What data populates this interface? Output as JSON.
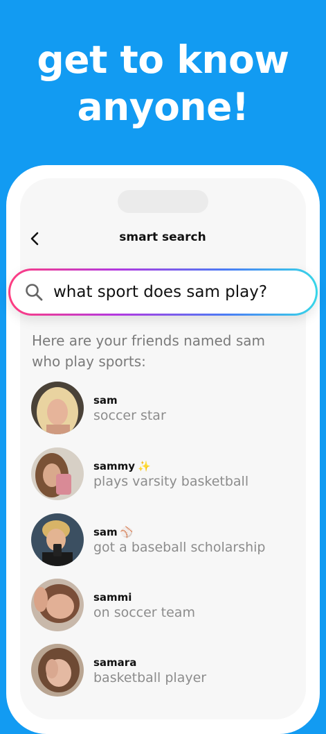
{
  "headline": {
    "line1": "get to know",
    "line2": "anyone!"
  },
  "nav": {
    "title": "smart search",
    "back_icon": "chevron-left-icon"
  },
  "search": {
    "query": "what sport does sam play?",
    "icon": "search-icon"
  },
  "intro": "Here are your friends named sam who play sports:",
  "results": [
    {
      "name": "sam",
      "emoji": "",
      "description": "soccer star"
    },
    {
      "name": "sammy",
      "emoji": "✨",
      "description": "plays varsity basketball"
    },
    {
      "name": "sam",
      "emoji": "⚾",
      "description": "got a baseball scholarship"
    },
    {
      "name": "sammi",
      "emoji": "",
      "description": "on soccer team"
    },
    {
      "name": "samara",
      "emoji": "",
      "description": "basketball player"
    }
  ],
  "colors": {
    "background": "#129BF2",
    "gradient": [
      "#FF3D7F",
      "#B338E0",
      "#4B7BF5",
      "#37D6E8"
    ]
  }
}
